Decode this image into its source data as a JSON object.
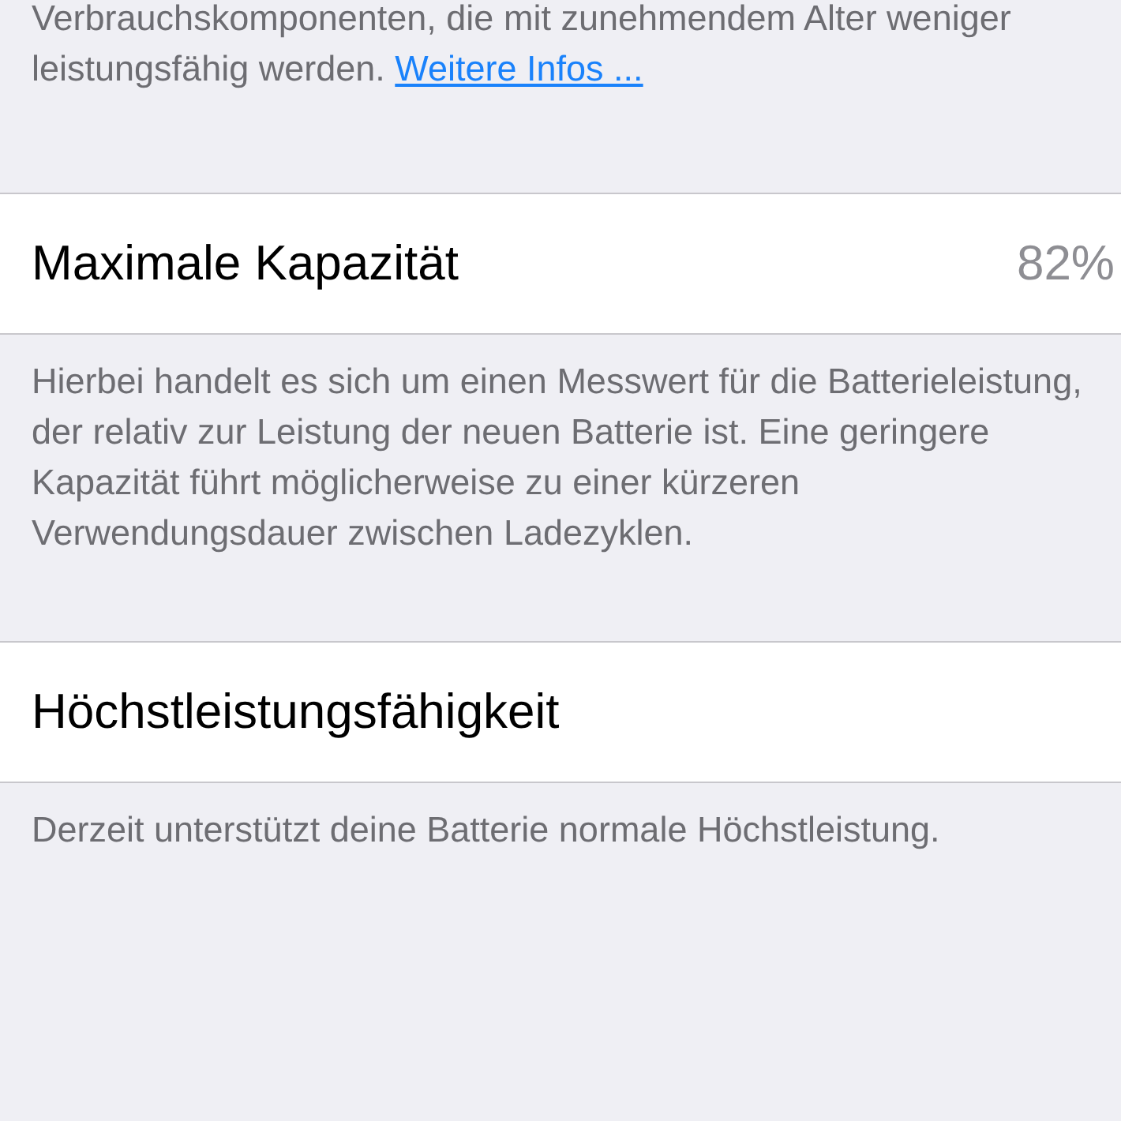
{
  "intro": {
    "text": "Verbrauchskomponenten, die mit zunehmendem Alter weniger leistungsfähig werden.",
    "link": "Weitere Infos ..."
  },
  "sections": [
    {
      "label": "Maximale Kapazität",
      "value": "82%",
      "footer": "Hierbei handelt es sich um einen Messwert für die Batterieleistung, der relativ zur Leistung der neuen Batterie ist. Eine geringere Kapazität führt möglicherweise zu einer kürzeren Verwendungsdauer zwischen Ladezyklen."
    },
    {
      "label": "Höchstleistungsfähigkeit",
      "footer": "Derzeit unterstützt deine Batterie normale Höchstleistung."
    }
  ]
}
